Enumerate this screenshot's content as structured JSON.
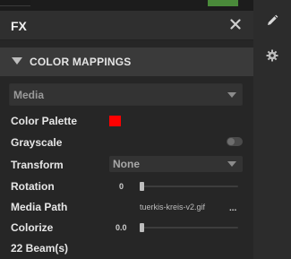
{
  "panel": {
    "title": "FX",
    "section_title": "COLOR MAPPINGS"
  },
  "fields": {
    "media_select_value": "Media",
    "color_palette_label": "Color Palette",
    "color_palette_color": "#ff0000",
    "grayscale_label": "Grayscale",
    "grayscale_on": false,
    "transform_label": "Transform",
    "transform_value": "None",
    "rotation_label": "Rotation",
    "rotation_value": "0",
    "media_path_label": "Media Path",
    "media_path_value": "tuerkis-kreis-v2.gif",
    "media_path_more": "...",
    "colorize_label": "Colorize",
    "colorize_value": "0.0"
  },
  "footer": {
    "beams": "22 Beam(s)"
  },
  "rail": {
    "items": [
      "pencil-icon",
      "gear-icon"
    ]
  },
  "colors": {
    "accent_green": "#4a8a3a",
    "section_bg": "#3a3a3a",
    "palette_red": "#ff0000"
  }
}
